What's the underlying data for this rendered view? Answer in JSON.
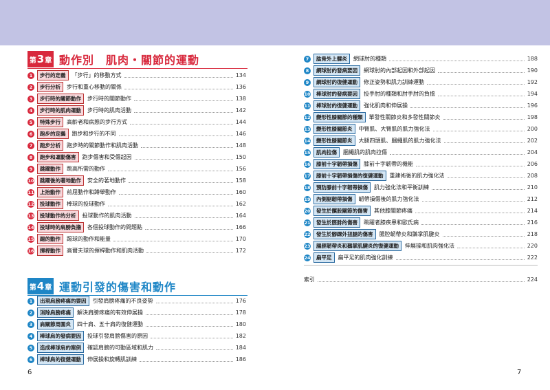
{
  "left": {
    "chapter3": {
      "badge_pre": "第",
      "badge_num": "3",
      "badge_post": "章",
      "title": "動作別　肌肉・關節的運動",
      "items": [
        {
          "n": "1",
          "tag": "步行的定義",
          "desc": "「步行」的移動方式",
          "page": "134"
        },
        {
          "n": "2",
          "tag": "步行分析",
          "desc": "步行和重心移動的關係",
          "page": "136"
        },
        {
          "n": "3",
          "tag": "步行時的關節動作",
          "desc": "步行時的關節動作",
          "page": "138"
        },
        {
          "n": "4",
          "tag": "步行時的肌肉運動",
          "desc": "步行時的肌肉活動",
          "page": "142"
        },
        {
          "n": "5",
          "tag": "特殊步行",
          "desc": "高齡者和病態的步行方式",
          "page": "144"
        },
        {
          "n": "6",
          "tag": "跑步的定義",
          "desc": "跑步和步行的不同",
          "page": "146"
        },
        {
          "n": "7",
          "tag": "跑步分析",
          "desc": "跑步時的關節動作和肌肉活動",
          "page": "148"
        },
        {
          "n": "8",
          "tag": "跑步和運動傷害",
          "desc": "跑步傷害和受傷起因",
          "page": "150"
        },
        {
          "n": "9",
          "tag": "跳躍動作",
          "desc": "跳高所需的動作",
          "page": "156"
        },
        {
          "n": "10",
          "tag": "跳躍後的著地動作",
          "desc": "安全的著地動作",
          "page": "158"
        },
        {
          "n": "11",
          "tag": "上抬動作",
          "desc": "前屈動作和蹲舉動作",
          "page": "160"
        },
        {
          "n": "12",
          "tag": "投球動作",
          "desc": "棒球的投球動作",
          "page": "162"
        },
        {
          "n": "13",
          "tag": "投球動作的分析",
          "desc": "投球動作的肌肉活動",
          "page": "164"
        },
        {
          "n": "14",
          "tag": "投球時的肩膀負擔",
          "desc": "各個投球動作的問題點",
          "page": "166"
        },
        {
          "n": "15",
          "tag": "踢的動作",
          "desc": "踢球的動作和能量",
          "page": "170"
        },
        {
          "n": "16",
          "tag": "揮桿動作",
          "desc": "高爾夫球的揮桿動作和肌肉活動",
          "page": "172"
        }
      ]
    },
    "chapter4": {
      "badge_pre": "第",
      "badge_num": "4",
      "badge_post": "章",
      "title": "運動引發的傷害和動作",
      "items": [
        {
          "n": "1",
          "tag": "出現肩膀疼痛的要因",
          "desc": "引發肩膀疼痛的不良姿勢",
          "page": "176"
        },
        {
          "n": "2",
          "tag": "消除肩膀疼痛",
          "desc": "解決肩膀疼痛的有效伸展操",
          "page": "178"
        },
        {
          "n": "3",
          "tag": "肩關節周圍炎",
          "desc": "四十肩、五十肩的復健運動",
          "page": "180"
        },
        {
          "n": "4",
          "tag": "棒球肩的發病要因",
          "desc": "投球引發肩膀傷害的原因",
          "page": "182"
        },
        {
          "n": "5",
          "tag": "造成棒球肩的案例",
          "desc": "確認肩膀的可動區域和肌力",
          "page": "184"
        },
        {
          "n": "6",
          "tag": "棒球肩的復健運動",
          "desc": "伸展操和旋轉肌訓練",
          "page": "186"
        }
      ]
    },
    "folio": "6"
  },
  "right": {
    "items": [
      {
        "n": "7",
        "tag": "肱骨外上髁炎",
        "desc": "網球肘的種類",
        "page": "188"
      },
      {
        "n": "8",
        "tag": "網球肘的發病要因",
        "desc": "網球肘的內部起因和外部起因",
        "page": "190"
      },
      {
        "n": "9",
        "tag": "網球肘的復健運動",
        "desc": "修正姿勢和肌力訓練運動",
        "page": "192"
      },
      {
        "n": "10",
        "tag": "棒球肘的發病要因",
        "desc": "投手肘的種類和肘手肘的負擔",
        "page": "194"
      },
      {
        "n": "11",
        "tag": "棒球肘的復健運動",
        "desc": "強化肌肉和伸展操",
        "page": "196"
      },
      {
        "n": "12",
        "tag": "變形性膝關節的種類",
        "desc": "單發性關節炎和多發性關節炎",
        "page": "198"
      },
      {
        "n": "13",
        "tag": "變形性膝關節炎",
        "desc": "中臀肌、大臀肌的肌力強化法",
        "page": "200"
      },
      {
        "n": "14",
        "tag": "變形性膝關節炎",
        "desc": "大腿四頭肌、膕繩肌的肌力強化法",
        "page": "202"
      },
      {
        "n": "15",
        "tag": "肌肉拉傷",
        "desc": "膕繩肌的肌肉拉傷",
        "page": "204"
      },
      {
        "n": "16",
        "tag": "膝前十字韌帶損傷",
        "desc": "膝前十字韌帶的機能",
        "page": "206"
      },
      {
        "n": "17",
        "tag": "膝前十字韌帶損傷的復健運動",
        "desc": "重建術後的肌力強化法",
        "page": "208"
      },
      {
        "n": "18",
        "tag": "預防膝前十字韌帶損傷",
        "desc": "肌力強化法和平衡訓練",
        "page": "210"
      },
      {
        "n": "19",
        "tag": "內側副韌帶損傷",
        "desc": "韌帶損傷後的肌力強化法",
        "page": "212"
      },
      {
        "n": "20",
        "tag": "發生於髕股關節的傷害",
        "desc": "其他膝關節疼痛",
        "page": "214"
      },
      {
        "n": "21",
        "tag": "發生於脛腓的傷害",
        "desc": "跳躍者膝疾患和歐氏病",
        "page": "216"
      },
      {
        "n": "22",
        "tag": "發生於腳踝外扭腿的傷害",
        "desc": "腸腔韌帶炎和鵝掌肌腱炎",
        "page": "218"
      },
      {
        "n": "23",
        "tag": "腸脛韌帶炎和鵝掌肌腱炎的復健運動",
        "desc": "伸展操和肌肉強化法",
        "page": "220"
      },
      {
        "n": "24",
        "tag": "扁平足",
        "desc": "扁平足的肌肉強化訓練",
        "page": "222"
      }
    ],
    "index_label": "索引",
    "index_page": "224",
    "folio": "7"
  }
}
